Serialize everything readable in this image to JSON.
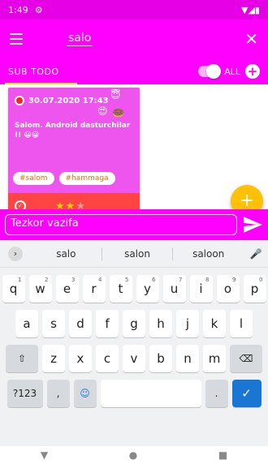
{
  "status": {
    "time": "1:49",
    "gear_icon": "gear-icon",
    "signal": "▼◢▮"
  },
  "appbar": {
    "search_value": "salo",
    "close_label": "✕"
  },
  "tabs": {
    "sub_todo": "SUB TODO",
    "all_label": "ALL"
  },
  "card": {
    "date": "30.07.2020 17:43",
    "text": "Salom. Android dasturchilar !! 😀😀",
    "tags": [
      "#salom",
      "#hammaga"
    ],
    "stars": 2,
    "stars_total": 3
  },
  "input": {
    "placeholder": "Tezkor vazifa"
  },
  "keyboard": {
    "suggestions": [
      "salo",
      "salon",
      "saloon"
    ],
    "row1": [
      "q",
      "w",
      "e",
      "r",
      "t",
      "y",
      "u",
      "i",
      "o",
      "p"
    ],
    "row1_sup": [
      "1",
      "2",
      "3",
      "4",
      "5",
      "6",
      "7",
      "8",
      "9",
      "0"
    ],
    "row2": [
      "a",
      "s",
      "d",
      "f",
      "g",
      "h",
      "j",
      "k",
      "l"
    ],
    "row3": [
      "z",
      "x",
      "c",
      "v",
      "b",
      "n",
      "m"
    ],
    "symbols_key": "?123",
    "comma": ",",
    "period": "."
  },
  "colors": {
    "primary": "#ff00ff",
    "accent": "#ffc107",
    "card": "#ee55ee",
    "card_footer": "#ff4444"
  }
}
